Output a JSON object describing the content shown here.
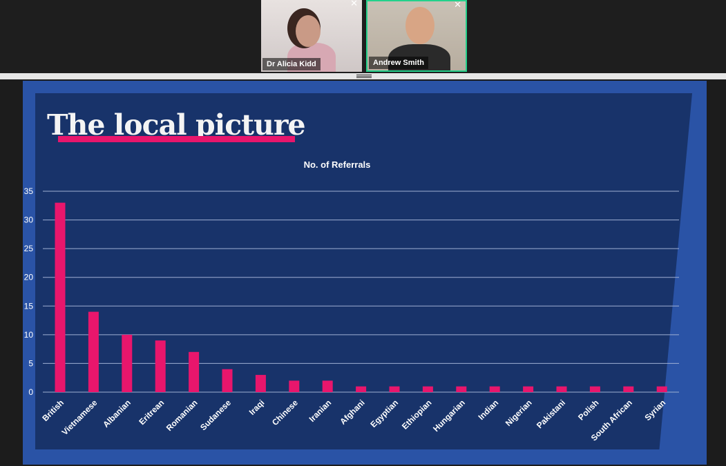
{
  "participants": [
    {
      "name": "Dr Alicia Kidd",
      "close_icon": "close-icon"
    },
    {
      "name": "Andrew Smith",
      "close_icon": "close-icon"
    }
  ],
  "slide": {
    "title": "The local picture",
    "accent_color": "#e8166c",
    "background_color": "#18336a",
    "frame_color": "#2a53a6"
  },
  "chart_data": {
    "type": "bar",
    "title": "No. of Referrals",
    "xlabel": "",
    "ylabel": "",
    "categories": [
      "British",
      "Vietnamese",
      "Albanian",
      "Eritrean",
      "Romanian",
      "Sudanese",
      "Iraqi",
      "Chinese",
      "Iranian",
      "Afghani",
      "Egyptian",
      "Ethiopian",
      "Hungarian",
      "Indian",
      "Nigerian",
      "Pakistani",
      "Polish",
      "South African",
      "Syrian"
    ],
    "values": [
      33,
      14,
      10,
      9,
      7,
      4,
      3,
      2,
      2,
      1,
      1,
      1,
      1,
      1,
      1,
      1,
      1,
      1,
      1
    ],
    "ylim": [
      0,
      35
    ],
    "yticks": [
      0,
      5,
      10,
      15,
      20,
      25,
      30,
      35
    ],
    "grid": true,
    "legend": "none",
    "bar_color": "#e8166c"
  }
}
